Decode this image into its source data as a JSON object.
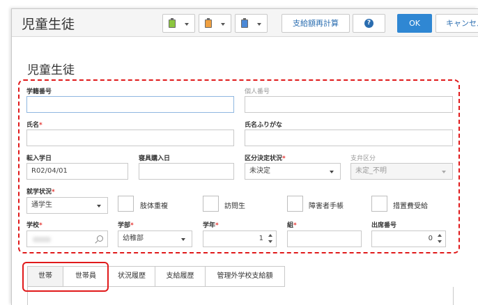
{
  "header": {
    "title": "児童生徒",
    "recalc_label": "支給額再計算",
    "ok_label": "OK",
    "cancel_label": "キャンセル",
    "tool_buttons": [
      {
        "icon": "clipboard-green-icon",
        "color": "#8cc63f"
      },
      {
        "icon": "clipboard-orange-icon",
        "color": "#f0a040"
      },
      {
        "icon": "clipboard-blue-icon",
        "color": "#4a88d6"
      }
    ],
    "help_icon": "question-circle-icon"
  },
  "form": {
    "section_title": "児童生徒",
    "student_number": {
      "label": "学籍番号",
      "value": ""
    },
    "personal_number": {
      "label": "個人番号",
      "value": ""
    },
    "name": {
      "label": "氏名",
      "value": ""
    },
    "name_kana": {
      "label": "氏名ふりがな",
      "value": ""
    },
    "transfer_date": {
      "label": "転入学日",
      "value": "R02/04/01"
    },
    "bedding_date": {
      "label": "寝具購入日",
      "value": ""
    },
    "category_status": {
      "label": "区分決定状況",
      "value": "未決定"
    },
    "payment_category": {
      "label": "支弁区分",
      "value": "未定_不明"
    },
    "enrollment_status": {
      "label": "就学状況",
      "value": "通学生"
    },
    "checkboxes": [
      {
        "label": "肢体重複",
        "checked": false
      },
      {
        "label": "訪問生",
        "checked": false
      },
      {
        "label": "障害者手帳",
        "checked": false
      },
      {
        "label": "措置費受給",
        "checked": false
      }
    ],
    "school": {
      "label": "学校",
      "value": ""
    },
    "department": {
      "label": "学部",
      "value": "幼稚部"
    },
    "grade": {
      "label": "学年",
      "value": "1"
    },
    "class": {
      "label": "組",
      "value": ""
    },
    "attendance_number": {
      "label": "出席番号",
      "value": "0"
    },
    "required_mark": "*"
  },
  "tabs": [
    {
      "label": "世帯",
      "active": true
    },
    {
      "label": "世帯員",
      "active": false
    },
    {
      "label": "状況履歴",
      "active": false
    },
    {
      "label": "支給履歴",
      "active": false
    },
    {
      "label": "管理外学校支給額",
      "active": false
    }
  ],
  "colors": {
    "accent": "#2f87d3",
    "required": "#e53935",
    "highlight": "#e0191a"
  }
}
